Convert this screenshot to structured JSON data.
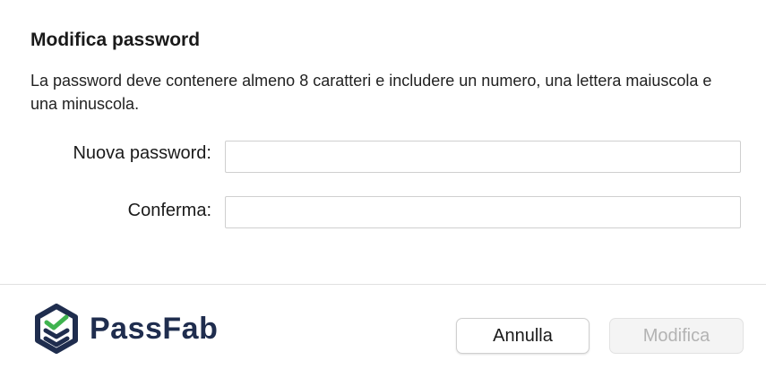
{
  "dialog": {
    "title": "Modifica password",
    "description": "La password deve contenere almeno 8 caratteri e includere un numero, una lettera maiuscola e una minuscola."
  },
  "form": {
    "new_password": {
      "label": "Nuova password:",
      "value": "",
      "placeholder": ""
    },
    "confirm": {
      "label": "Conferma:",
      "value": "",
      "placeholder": ""
    }
  },
  "footer": {
    "logo_text": "PassFab",
    "cancel_label": "Annulla",
    "modify_label": "Modifica",
    "modify_enabled": false
  },
  "colors": {
    "brand_navy": "#1f2d4e",
    "brand_green": "#3fb34f",
    "disabled_text": "#b3b3b3"
  }
}
